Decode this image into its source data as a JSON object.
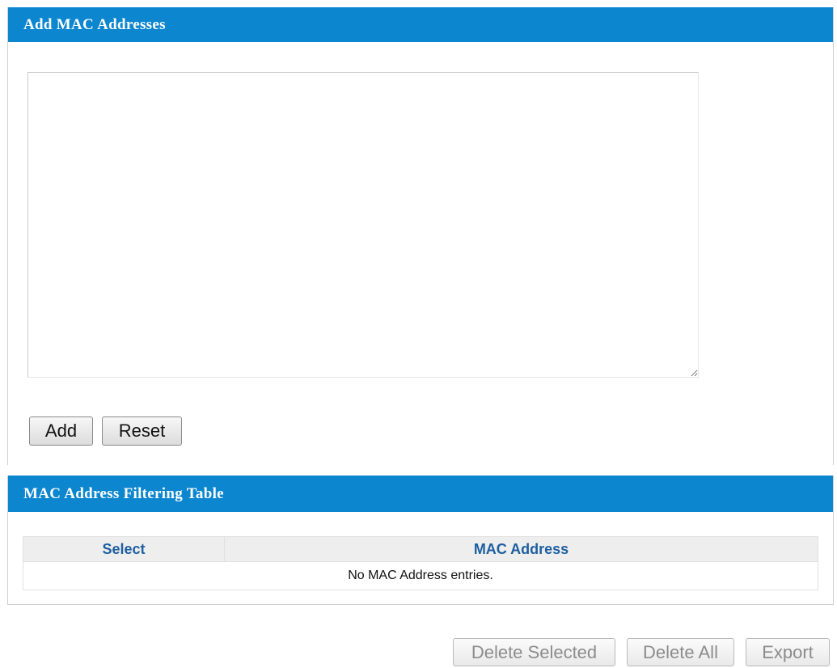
{
  "add_panel": {
    "title": "Add MAC Addresses",
    "textarea_value": "",
    "add_label": "Add",
    "reset_label": "Reset"
  },
  "table_panel": {
    "title": "MAC Address Filtering Table",
    "columns": [
      "Select",
      "MAC Address"
    ],
    "empty_message": "No MAC Address entries."
  },
  "actions": {
    "delete_selected_label": "Delete Selected",
    "delete_all_label": "Delete All",
    "export_label": "Export"
  },
  "colors": {
    "header_bg": "#0b86cf",
    "table_header_text": "#1e5fa0",
    "disabled_text": "#8c8c8c"
  }
}
